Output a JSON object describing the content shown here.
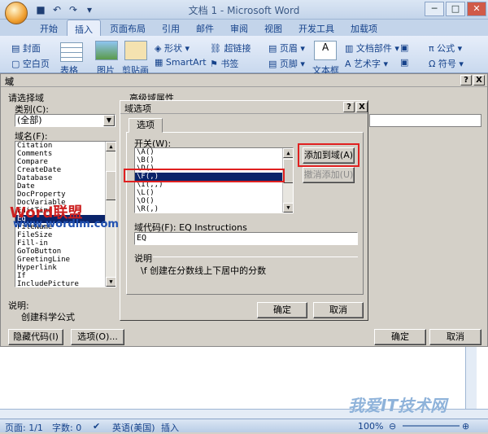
{
  "window": {
    "title": "文档 1 - Microsoft Word",
    "qat": [
      "save-icon",
      "undo-icon",
      "redo-icon",
      "customize-icon"
    ]
  },
  "tabs": [
    "开始",
    "插入",
    "页面布局",
    "引用",
    "邮件",
    "审阅",
    "视图",
    "开发工具",
    "加载项"
  ],
  "active_tab": "插入",
  "ribbon": {
    "cover": "封面",
    "blank_page": "空白页",
    "table_label": "表格",
    "picture": "图片",
    "clipart": "剪贴画",
    "shapes": "形状",
    "smartart": "SmartArt",
    "hyperlink": "超链接",
    "bookmark": "书签",
    "header": "页眉",
    "footer": "页脚",
    "textbox": "文本框",
    "doc_parts": "文档部件",
    "wordart": "艺术字",
    "formula": "公式",
    "symbol": "符号"
  },
  "field_dialog": {
    "title": "域",
    "help_btn": "?",
    "close_btn": "X",
    "choose_field": "请选择域",
    "category_label": "类别(C):",
    "category_value": "(全部)",
    "field_name_label": "域名(F):",
    "field_names": [
      "Citation",
      "Comments",
      "Compare",
      "CreateDate",
      "Database",
      "Date",
      "DocProperty",
      "DocVariable",
      "EditTime",
      "Eq",
      "FileName",
      "FileSize",
      "Fill-in",
      "GoToButton",
      "GreetingLine",
      "Hyperlink",
      "If",
      "IncludePicture"
    ],
    "selected_field": "Eq",
    "advanced_props": "高级域属性",
    "description_label": "说明:",
    "description_text": "创建科学公式",
    "hide_codes_btn": "隐藏代码(I)",
    "options_btn": "选项(O)...",
    "ok_btn": "确定",
    "cancel_btn": "取消"
  },
  "options_dialog": {
    "title": "域选项",
    "help_btn": "?",
    "close_btn": "X",
    "tab": "选项",
    "switches_label": "开关(W):",
    "switches": [
      "\\A()",
      "\\B()",
      "\\D()",
      "\\F(,)",
      "\\I(,,)",
      "\\L()",
      "\\O()",
      "\\R(,)"
    ],
    "selected_switch": "\\F(,)",
    "add_btn": "添加到域(A)",
    "undo_add_btn": "撤消添加(U)",
    "field_code_label": "域代码(F): EQ Instructions",
    "field_code_value": "EQ",
    "desc_label": "说明",
    "desc_text": "\\f 创建在分数线上下居中的分数",
    "ok_btn": "确定",
    "cancel_btn": "取消"
  },
  "status_bar": {
    "page": "页面: 1/1",
    "words": "字数: 0",
    "language": "英语(美国)",
    "mode": "插入",
    "zoom": "100%"
  },
  "watermarks": {
    "top_left": "Word联盟",
    "url": "www.wordlm.com",
    "bottom_right": "我爱IT技术网"
  },
  "colors": {
    "highlight": "#e02020",
    "selection": "#0a246a",
    "ribbon_text": "#15428b"
  }
}
